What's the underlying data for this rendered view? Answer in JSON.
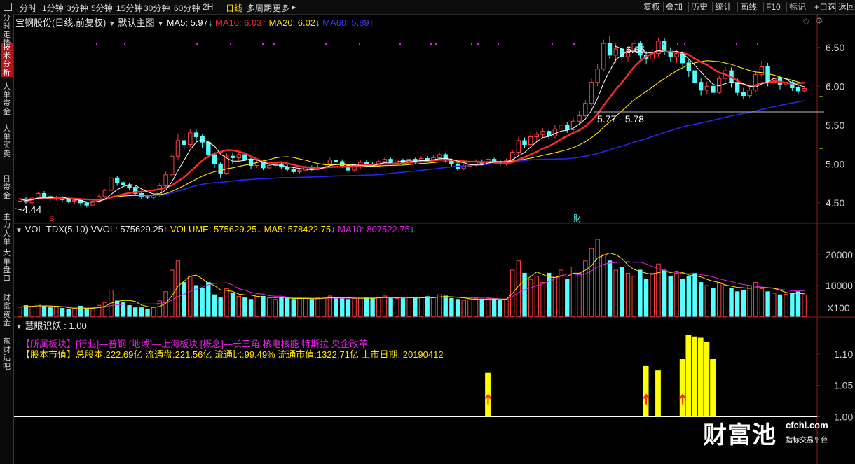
{
  "toolbar": {
    "periods": [
      "分时",
      "1分钟",
      "3分钟",
      "5分钟",
      "15分钟",
      "30分钟",
      "60分钟",
      "2H",
      "日线",
      "多周期",
      "更多"
    ],
    "active_period": "日线",
    "right_buttons": [
      "复权",
      "叠加",
      "历史",
      "统计",
      "画线",
      "F10",
      "标记",
      "+自选",
      "返回"
    ]
  },
  "sidebar": [
    "分时走势",
    "技术分析",
    "大单资金",
    "大单买卖",
    "日资金",
    "主力大单",
    "大单盘口",
    "财富资金",
    "东财贴吧"
  ],
  "main_panel": {
    "title": "宝钢股份(日线.前复权)",
    "template": "默认主图",
    "ma5": "MA5: 5.97",
    "ma10": "MA10: 6.03",
    "ma20": "MA20: 6.02",
    "ma60": "MA60: 5.89",
    "price_axis": [
      "6.50",
      "6.00",
      "5.50",
      "5.00",
      "4.50"
    ],
    "high_label": "6.65",
    "low_label": "4.44",
    "range_label": "5.77 - 5.78",
    "marker_s": "S",
    "marker_cai": "财"
  },
  "vol_panel": {
    "title": "VOL-TDX(5,10) VVOL: 575629.25",
    "volume": "VOLUME: 575629.25",
    "ma5": "MA5: 578422.75",
    "ma10": "MA10: 807522.75",
    "axis": [
      "20000",
      "10000"
    ],
    "unit": "X100"
  },
  "ind_panel": {
    "title": "慧眼识妖",
    "value": ": 1.00",
    "axis": [
      "1.10",
      "1.05",
      "1.00"
    ],
    "line1_tag": "【所属板块】",
    "line1_text": "[行业]—普钢 [地域]—上海板块 [概念]—长三角 核电核能 特斯拉 央企改革",
    "line2_tag": "【股本市值】",
    "line2_text": "总股本:222.69亿 流通盘:221.56亿 流通比:99.49% 流通市值:1322.71亿 上市日期: 20190412"
  },
  "watermark": {
    "brand": "财富池",
    "site": "cfchi.com",
    "slogan": "指标交易平台"
  },
  "colors": {
    "up": "#ff4040",
    "down": "#54ffff",
    "ma5": "#ffffff",
    "ma10": "#ff2b2b",
    "ma20": "#ffe600",
    "ma60": "#2525e8",
    "mag": "#e020e0"
  },
  "chart_data": {
    "type": "candlestick",
    "price_range": [
      4.3,
      6.75
    ],
    "volume_range": [
      0,
      25000
    ],
    "indicator_range": [
      0.995,
      1.14
    ],
    "candles": [
      [
        4.52,
        4.55,
        4.48,
        4.57
      ],
      [
        4.55,
        4.51,
        4.49,
        4.58
      ],
      [
        4.5,
        4.56,
        4.47,
        4.58
      ],
      [
        4.56,
        4.62,
        4.54,
        4.64
      ],
      [
        4.62,
        4.58,
        4.56,
        4.65
      ],
      [
        4.58,
        4.55,
        4.52,
        4.6
      ],
      [
        4.55,
        4.57,
        4.53,
        4.59
      ],
      [
        4.57,
        4.54,
        4.52,
        4.59
      ],
      [
        4.54,
        4.52,
        4.5,
        4.56
      ],
      [
        4.52,
        4.53,
        4.49,
        4.55
      ],
      [
        4.53,
        4.5,
        4.45,
        4.55
      ],
      [
        4.5,
        4.47,
        4.44,
        4.52
      ],
      [
        4.47,
        4.52,
        4.44,
        4.54
      ],
      [
        4.52,
        4.58,
        4.5,
        4.61
      ],
      [
        4.58,
        4.66,
        4.56,
        4.68
      ],
      [
        4.66,
        4.82,
        4.64,
        4.86
      ],
      [
        4.82,
        4.76,
        4.72,
        4.85
      ],
      [
        4.76,
        4.73,
        4.7,
        4.78
      ],
      [
        4.73,
        4.7,
        4.67,
        4.75
      ],
      [
        4.7,
        4.62,
        4.6,
        4.72
      ],
      [
        4.62,
        4.58,
        4.55,
        4.64
      ],
      [
        4.58,
        4.57,
        4.55,
        4.6
      ],
      [
        4.57,
        4.6,
        4.54,
        4.62
      ],
      [
        4.6,
        4.72,
        4.58,
        4.75
      ],
      [
        4.72,
        4.86,
        4.7,
        4.9
      ],
      [
        4.86,
        5.1,
        4.84,
        5.15
      ],
      [
        5.1,
        5.3,
        5.05,
        5.38
      ],
      [
        5.3,
        5.25,
        5.18,
        5.4
      ],
      [
        5.25,
        5.4,
        5.22,
        5.45
      ],
      [
        5.4,
        5.35,
        5.28,
        5.44
      ],
      [
        5.35,
        5.28,
        5.2,
        5.38
      ],
      [
        5.28,
        5.12,
        5.08,
        5.3
      ],
      [
        5.12,
        5.0,
        4.95,
        5.15
      ],
      [
        5.0,
        4.88,
        4.82,
        5.03
      ],
      [
        4.88,
        5.1,
        4.86,
        5.14
      ],
      [
        5.1,
        5.08,
        5.0,
        5.15
      ],
      [
        5.08,
        5.12,
        5.04,
        5.16
      ],
      [
        5.12,
        5.05,
        5.0,
        5.15
      ],
      [
        5.05,
        4.98,
        4.94,
        5.08
      ],
      [
        4.98,
        5.02,
        4.95,
        5.06
      ],
      [
        5.02,
        4.95,
        4.92,
        5.05
      ],
      [
        4.95,
        4.98,
        4.93,
        5.02
      ],
      [
        4.98,
        5.0,
        4.95,
        5.04
      ],
      [
        5.0,
        4.96,
        4.94,
        5.03
      ],
      [
        4.96,
        4.93,
        4.9,
        4.99
      ],
      [
        4.93,
        4.9,
        4.88,
        4.96
      ],
      [
        4.9,
        4.92,
        4.87,
        4.95
      ],
      [
        4.92,
        4.95,
        4.9,
        4.98
      ],
      [
        4.95,
        4.93,
        4.91,
        4.98
      ],
      [
        4.93,
        4.96,
        4.92,
        4.99
      ],
      [
        4.96,
        5.0,
        4.94,
        5.03
      ],
      [
        5.0,
        5.05,
        4.98,
        5.08
      ],
      [
        5.05,
        5.03,
        5.0,
        5.08
      ],
      [
        5.03,
        4.98,
        4.95,
        5.06
      ],
      [
        4.98,
        4.92,
        4.9,
        5.0
      ],
      [
        4.92,
        4.96,
        4.9,
        4.99
      ],
      [
        4.96,
        5.02,
        4.94,
        5.05
      ],
      [
        5.02,
        5.0,
        4.97,
        5.05
      ],
      [
        5.0,
        4.98,
        4.96,
        5.03
      ],
      [
        4.98,
        5.03,
        4.96,
        5.06
      ],
      [
        5.03,
        5.06,
        5.0,
        5.09
      ],
      [
        5.06,
        5.02,
        5.0,
        5.08
      ],
      [
        5.02,
        5.05,
        5.0,
        5.08
      ],
      [
        5.05,
        5.01,
        4.98,
        5.07
      ],
      [
        5.01,
        5.06,
        4.99,
        5.09
      ],
      [
        5.06,
        5.03,
        5.0,
        5.08
      ],
      [
        5.03,
        5.07,
        5.01,
        5.1
      ],
      [
        5.07,
        5.04,
        5.02,
        5.1
      ],
      [
        5.04,
        5.08,
        5.02,
        5.11
      ],
      [
        5.08,
        5.12,
        5.05,
        5.15
      ],
      [
        5.12,
        5.05,
        5.02,
        5.14
      ],
      [
        5.05,
        5.0,
        4.96,
        5.07
      ],
      [
        5.0,
        4.94,
        4.91,
        5.02
      ],
      [
        4.94,
        4.97,
        4.92,
        5.0
      ],
      [
        4.97,
        4.99,
        4.95,
        5.02
      ],
      [
        4.99,
        5.03,
        4.97,
        5.06
      ],
      [
        5.03,
        5.01,
        4.98,
        5.06
      ],
      [
        5.01,
        5.06,
        4.99,
        5.09
      ],
      [
        5.06,
        5.03,
        5.0,
        5.08
      ],
      [
        5.03,
        5.0,
        4.97,
        5.06
      ],
      [
        5.0,
        5.04,
        4.98,
        5.07
      ],
      [
        5.04,
        5.15,
        5.02,
        5.18
      ],
      [
        5.15,
        5.3,
        5.12,
        5.35
      ],
      [
        5.3,
        5.25,
        5.2,
        5.34
      ],
      [
        5.25,
        5.35,
        5.22,
        5.4
      ],
      [
        5.35,
        5.38,
        5.3,
        5.42
      ],
      [
        5.38,
        5.42,
        5.34,
        5.46
      ],
      [
        5.42,
        5.36,
        5.32,
        5.45
      ],
      [
        5.36,
        5.45,
        5.33,
        5.5
      ],
      [
        5.45,
        5.5,
        5.4,
        5.55
      ],
      [
        5.5,
        5.44,
        5.4,
        5.54
      ],
      [
        5.44,
        5.55,
        5.42,
        5.6
      ],
      [
        5.55,
        5.62,
        5.5,
        5.68
      ],
      [
        5.62,
        5.78,
        5.6,
        5.82
      ],
      [
        5.78,
        6.05,
        5.75,
        6.1
      ],
      [
        6.05,
        6.22,
        6.0,
        6.28
      ],
      [
        6.22,
        6.55,
        6.2,
        6.6
      ],
      [
        6.55,
        6.4,
        6.35,
        6.65
      ],
      [
        6.4,
        6.48,
        6.3,
        6.55
      ],
      [
        6.48,
        6.38,
        6.3,
        6.52
      ],
      [
        6.38,
        6.45,
        6.32,
        6.5
      ],
      [
        6.45,
        6.55,
        6.4,
        6.6
      ],
      [
        6.55,
        6.4,
        6.35,
        6.58
      ],
      [
        6.4,
        6.35,
        6.28,
        6.45
      ],
      [
        6.35,
        6.42,
        6.3,
        6.48
      ],
      [
        6.42,
        6.58,
        6.38,
        6.62
      ],
      [
        6.58,
        6.45,
        6.4,
        6.62
      ],
      [
        6.45,
        6.38,
        6.32,
        6.5
      ],
      [
        6.38,
        6.42,
        6.3,
        6.46
      ],
      [
        6.42,
        6.3,
        6.25,
        6.45
      ],
      [
        6.3,
        6.2,
        6.12,
        6.35
      ],
      [
        6.2,
        6.05,
        5.98,
        6.25
      ],
      [
        6.05,
        5.95,
        5.88,
        6.1
      ],
      [
        5.95,
        6.0,
        5.9,
        6.06
      ],
      [
        6.0,
        5.92,
        5.86,
        6.05
      ],
      [
        5.92,
        6.1,
        5.9,
        6.14
      ],
      [
        6.1,
        6.2,
        6.05,
        6.25
      ],
      [
        6.2,
        6.05,
        5.98,
        6.24
      ],
      [
        6.05,
        5.92,
        5.88,
        6.1
      ],
      [
        5.92,
        5.88,
        5.84,
        5.98
      ],
      [
        5.88,
        5.95,
        5.85,
        6.0
      ],
      [
        5.95,
        6.15,
        5.92,
        6.2
      ],
      [
        6.15,
        6.25,
        6.1,
        6.33
      ],
      [
        6.25,
        6.05,
        6.0,
        6.3
      ],
      [
        6.05,
        6.1,
        6.0,
        6.15
      ],
      [
        6.1,
        6.02,
        5.96,
        6.14
      ],
      [
        6.02,
        6.05,
        5.98,
        6.1
      ],
      [
        6.05,
        5.98,
        5.94,
        6.08
      ],
      [
        5.98,
        5.94,
        5.9,
        6.02
      ],
      [
        5.94,
        5.97,
        5.92,
        6.0
      ]
    ],
    "volume": [
      30,
      35,
      32,
      40,
      34,
      28,
      30,
      26,
      24,
      25,
      33,
      22,
      27,
      36,
      45,
      85,
      50,
      44,
      35,
      28,
      28,
      24,
      30,
      50,
      80,
      150,
      180,
      110,
      130,
      100,
      90,
      110,
      70,
      60,
      90,
      75,
      65,
      60,
      55,
      70,
      65,
      60,
      55,
      62,
      58,
      55,
      60,
      58,
      55,
      60,
      62,
      66,
      58,
      60,
      55,
      58,
      62,
      60,
      58,
      62,
      66,
      60,
      58,
      62,
      60,
      58,
      62,
      64,
      60,
      70,
      66,
      58,
      55,
      52,
      54,
      58,
      56,
      60,
      55,
      52,
      56,
      150,
      180,
      140,
      120,
      130,
      110,
      140,
      130,
      150,
      120,
      160,
      140,
      180,
      220,
      250,
      200,
      180,
      150,
      160,
      140,
      130,
      150,
      120,
      140,
      170,
      150,
      130,
      140,
      120,
      130,
      140,
      110,
      100,
      90,
      110,
      100,
      90,
      80,
      85,
      100,
      110,
      90,
      80,
      75,
      70,
      72,
      75,
      80,
      70
    ],
    "vol_ma5_ratio": 0.98,
    "indicator_bars": [
      [
        77,
        1.07
      ],
      [
        103,
        1.081
      ],
      [
        105,
        1.074
      ],
      [
        109,
        1.092
      ],
      [
        110,
        1.13
      ],
      [
        111,
        1.128
      ],
      [
        112,
        1.126
      ],
      [
        113,
        1.12
      ],
      [
        114,
        1.092
      ]
    ]
  }
}
